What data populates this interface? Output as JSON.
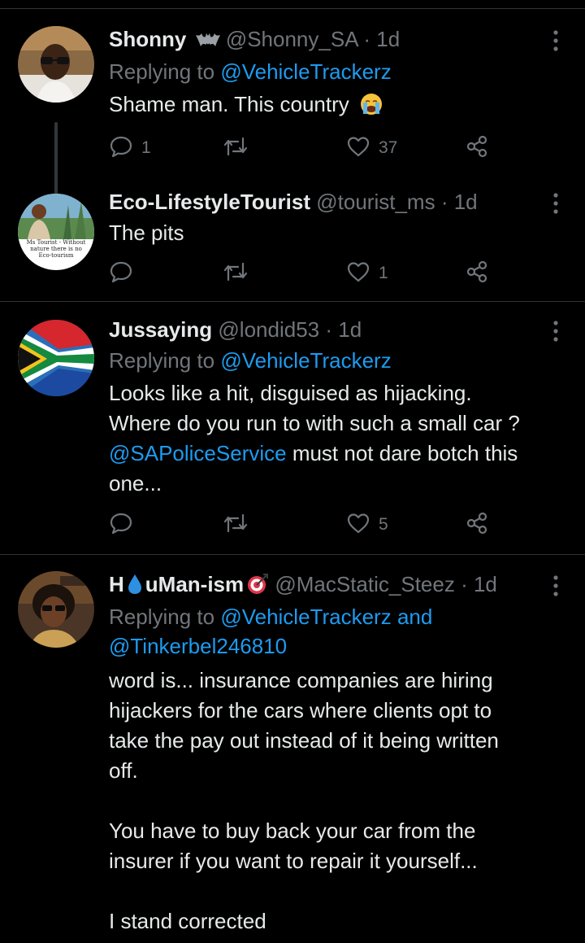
{
  "tweets": [
    {
      "name": "Shonny",
      "handle": "@Shonny_SA",
      "time": "1d",
      "reply_prefix": "Replying to",
      "reply_to": "@VehicleTrackerz",
      "text": "Shame man. This country",
      "replies": "1",
      "likes": "37"
    },
    {
      "name": "Eco-LifestyleTourist",
      "handle": "@tourist_ms",
      "time": "1d",
      "text": "The pits",
      "avatar_caption": [
        "Ms Tourist - Without",
        "nature there is no",
        "Eco-tourism"
      ],
      "likes": "1"
    },
    {
      "name": "Jussaying",
      "handle": "@londid53",
      "time": "1d",
      "reply_prefix": "Replying to",
      "reply_to": "@VehicleTrackerz",
      "lines": [
        "Looks like a hit, disguised as hijacking.",
        "Where do you run to with such a small car ?"
      ],
      "mention": "@SAPoliceService",
      "line3_rest": " must not dare botch this",
      "line4": "one...",
      "likes": "5"
    },
    {
      "name_prefix": "H",
      "name_mid": "uMan-ism",
      "handle": "@MacStatic_Steez",
      "time": "1d",
      "reply_prefix": "Replying to",
      "reply_to": "@VehicleTrackerz",
      "reply_and": "and",
      "reply_to2": "@Tinkerbel246810",
      "lines": [
        "word is... insurance companies are hiring",
        "hijackers for the cars where clients opt to",
        "take the pay out instead of it being written",
        "off.",
        "",
        "You have to buy back your car from the",
        "insurer if you want to repair it yourself...",
        "",
        "I stand corrected"
      ]
    }
  ],
  "icons": {
    "reply": "speech-bubble-icon",
    "retweet": "retweet-icon",
    "like": "heart-icon",
    "share": "share-icon",
    "more": "more-vertical-icon"
  },
  "colors": {
    "background": "#000000",
    "text": "#e7e9ea",
    "muted": "#71767b",
    "link": "#1d9bf0",
    "divider": "#2f3336"
  }
}
